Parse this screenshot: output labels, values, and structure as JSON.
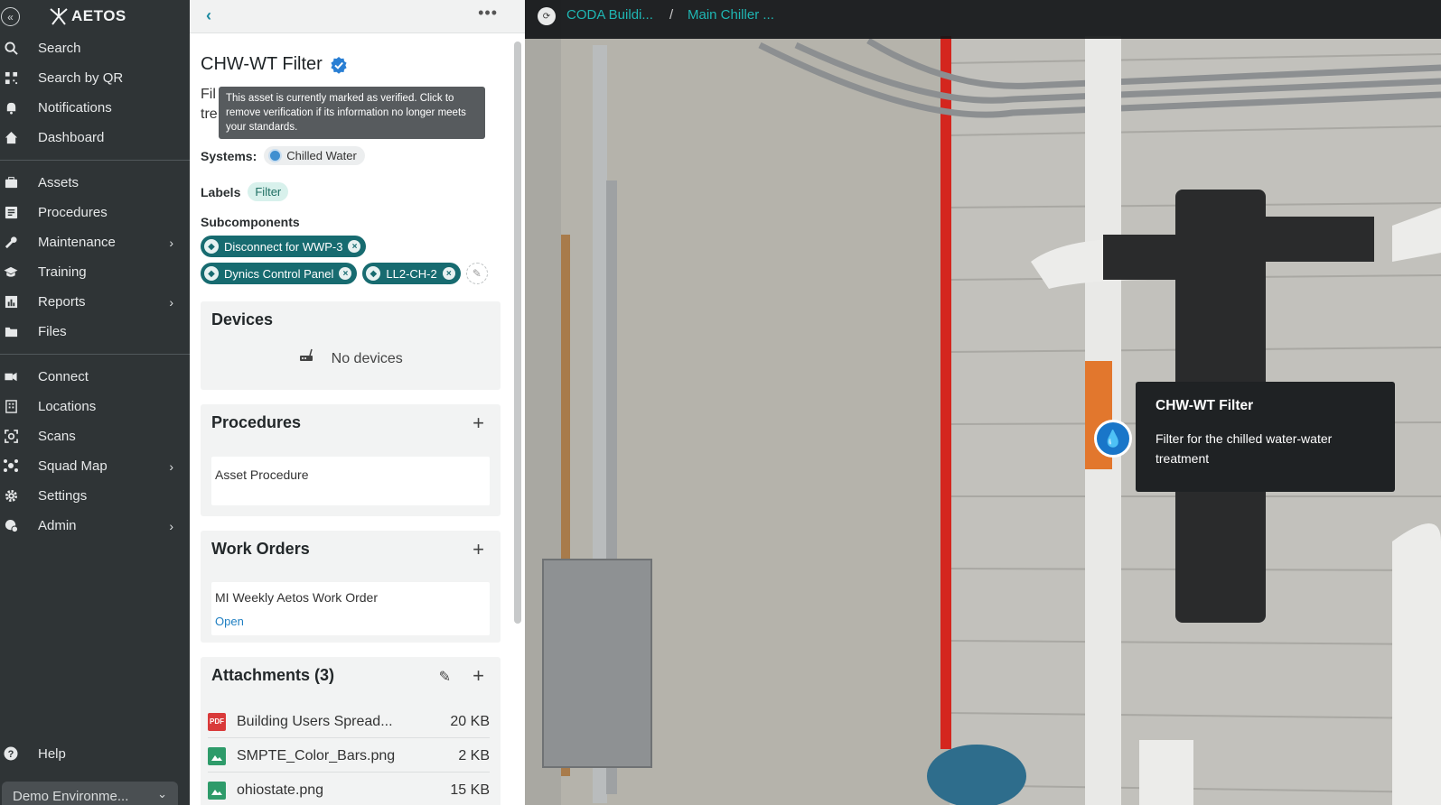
{
  "brand": {
    "name": "AETOS"
  },
  "nav": {
    "group1": [
      {
        "label": "Search",
        "icon": "search-icon"
      },
      {
        "label": "Search by QR",
        "icon": "qr-icon"
      },
      {
        "label": "Notifications",
        "icon": "bell-icon"
      },
      {
        "label": "Dashboard",
        "icon": "home-icon"
      }
    ],
    "group2": [
      {
        "label": "Assets",
        "icon": "briefcase-icon"
      },
      {
        "label": "Procedures",
        "icon": "list-icon"
      },
      {
        "label": "Maintenance",
        "icon": "wrench-icon",
        "has_submenu": true
      },
      {
        "label": "Training",
        "icon": "graduation-cap-icon"
      },
      {
        "label": "Reports",
        "icon": "chart-icon",
        "has_submenu": true
      },
      {
        "label": "Files",
        "icon": "folder-icon"
      }
    ],
    "group3": [
      {
        "label": "Connect",
        "icon": "plug-icon"
      },
      {
        "label": "Locations",
        "icon": "building-icon"
      },
      {
        "label": "Scans",
        "icon": "scan-icon"
      },
      {
        "label": "Squad Map",
        "icon": "network-icon",
        "has_submenu": true
      },
      {
        "label": "Settings",
        "icon": "gear-icon"
      },
      {
        "label": "Admin",
        "icon": "admin-icon",
        "has_submenu": true
      }
    ],
    "help": "Help",
    "environment": "Demo Environme..."
  },
  "asset": {
    "title": "CHW-WT Filter",
    "description_visible": "Fil\ntre",
    "verified_tooltip": "This asset is currently marked as verified. Click to remove verification if its information no longer meets your standards.",
    "systems_label": "Systems:",
    "systems": [
      "Chilled Water"
    ],
    "labels_label": "Labels",
    "labels": [
      "Filter"
    ],
    "subcomponents_label": "Subcomponents",
    "subcomponents": [
      "Disconnect for WWP-3",
      "Dynics Control Panel",
      "LL2-CH-2"
    ]
  },
  "devices": {
    "title": "Devices",
    "empty_text": "No devices"
  },
  "procedures": {
    "title": "Procedures",
    "items": [
      "Asset Procedure"
    ]
  },
  "work_orders": {
    "title": "Work Orders",
    "items": [
      {
        "name": "MI Weekly Aetos Work Order",
        "status": "Open"
      }
    ]
  },
  "attachments": {
    "title": "Attachments (3)",
    "items": [
      {
        "name": "Building Users Spread...",
        "size": "20 KB",
        "type": "pdf",
        "color": "#d93a3a",
        "icon_text": "PDF"
      },
      {
        "name": "SMPTE_Color_Bars.png",
        "size": "2 KB",
        "type": "image",
        "color": "#2e9b6a"
      },
      {
        "name": "ohiostate.png",
        "size": "15 KB",
        "type": "image",
        "color": "#2e9b6a"
      }
    ]
  },
  "viewer": {
    "breadcrumb": [
      "CODA Buildi...",
      "Main Chiller ..."
    ],
    "breadcrumb_sep": "/",
    "hotspot_title": "CHW-WT Filter",
    "hotspot_desc": "Filter for the chilled water-water treatment"
  },
  "colors": {
    "accent": "#176b70",
    "link": "#1fb6b3",
    "sidebar": "#2f3436"
  }
}
